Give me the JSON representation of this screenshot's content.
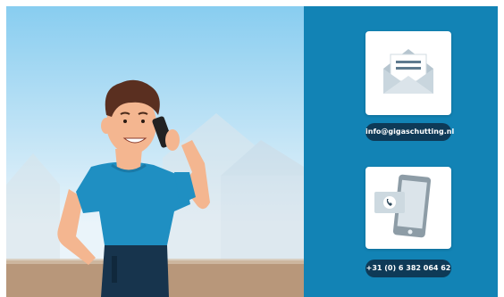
{
  "contact": {
    "email": {
      "label": "info@gigaschutting.nl",
      "icon": "envelope-icon"
    },
    "phone": {
      "label": "+31 (0) 6 382 064 62",
      "icon": "smartphone-call-icon"
    }
  },
  "illustration": {
    "subject": "man-on-phone-illustration"
  },
  "colors": {
    "panel": "#1283b5",
    "pill": "#0e3a57",
    "sky_top": "#88cdf0",
    "sky_bottom": "#eaf4fa",
    "ground": "#b8977a",
    "shirt": "#1f8fc2",
    "skin": "#f4b690",
    "hair": "#5a2f20",
    "jeans": "#17344d"
  }
}
